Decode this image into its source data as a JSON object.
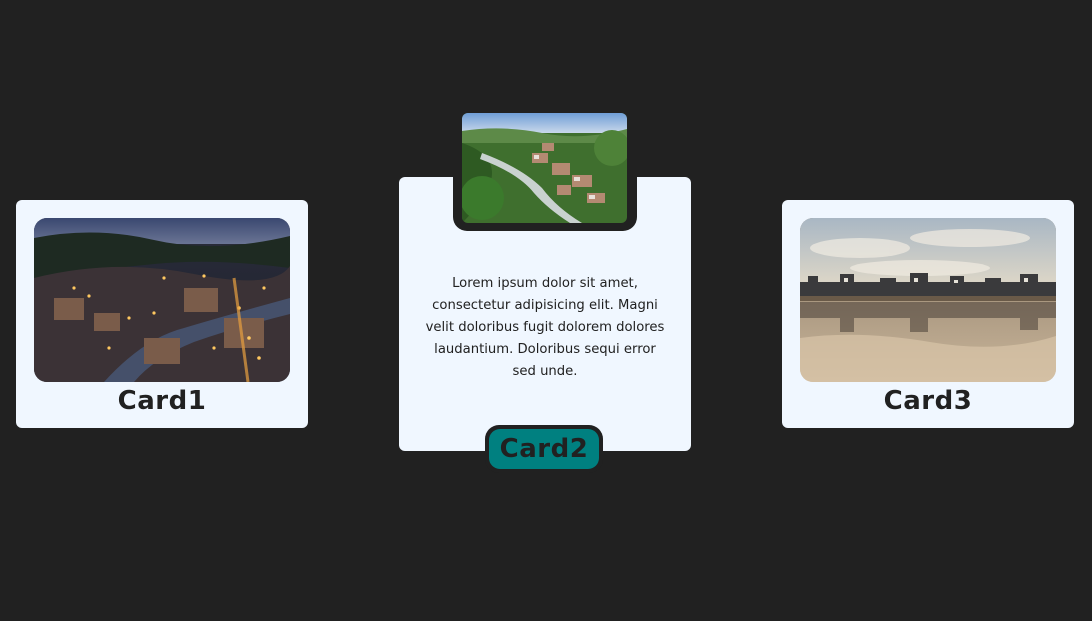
{
  "colors": {
    "page_background": "#212121",
    "card_background": "#f0f7ff",
    "badge_background": "#008080",
    "text": "#212121"
  },
  "cards": [
    {
      "title": "Card1",
      "image": "town-at-night-photo"
    },
    {
      "title": "Card2",
      "image": "town-aerial-photo",
      "text": "Lorem ipsum dolor sit amet, consectetur adipisicing elit. Magni velit doloribus fugit dolorem dolores laudantium. Doloribus sequi error sed unde."
    },
    {
      "title": "Card3",
      "image": "beach-reflection-photo"
    }
  ]
}
